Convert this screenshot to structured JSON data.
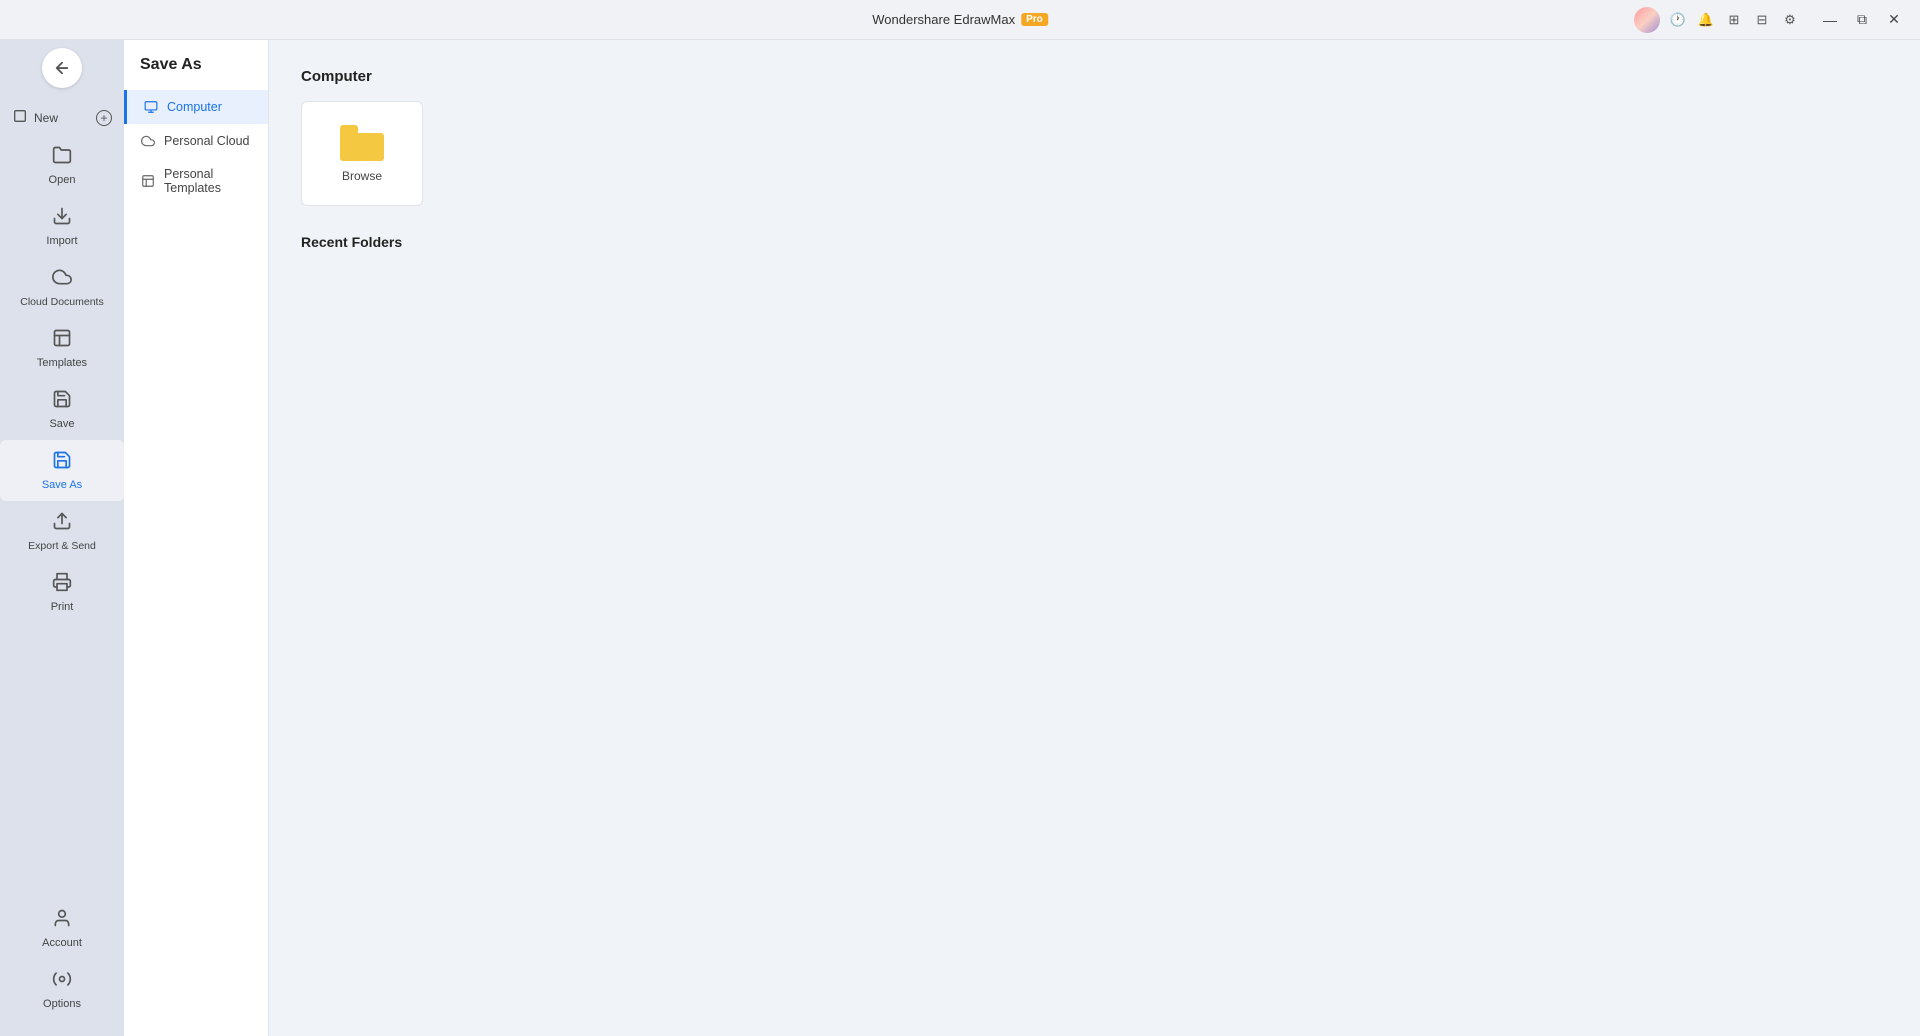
{
  "titleBar": {
    "appName": "Wondershare EdrawMax",
    "proBadge": "Pro",
    "winControls": {
      "minimize": "—",
      "restore": "⧉",
      "close": "✕"
    },
    "toolbarIcons": [
      "clock-icon",
      "bell-icon",
      "grid-icon",
      "filter-icon",
      "settings-icon"
    ]
  },
  "sidebar": {
    "backButton": "←",
    "navItems": [
      {
        "id": "new",
        "label": "New",
        "icon": "new-icon"
      },
      {
        "id": "open",
        "label": "Open",
        "icon": "open-icon"
      },
      {
        "id": "import",
        "label": "Import",
        "icon": "import-icon"
      },
      {
        "id": "cloud-documents",
        "label": "Cloud Documents",
        "icon": "cloud-icon"
      },
      {
        "id": "templates",
        "label": "Templates",
        "icon": "templates-icon"
      },
      {
        "id": "save",
        "label": "Save",
        "icon": "save-icon"
      },
      {
        "id": "save-as",
        "label": "Save As",
        "icon": "saveas-icon",
        "active": true
      },
      {
        "id": "export-send",
        "label": "Export & Send",
        "icon": "export-icon"
      },
      {
        "id": "print",
        "label": "Print",
        "icon": "print-icon"
      }
    ],
    "bottomItems": [
      {
        "id": "account",
        "label": "Account",
        "icon": "account-icon"
      },
      {
        "id": "options",
        "label": "Options",
        "icon": "options-icon"
      }
    ]
  },
  "saveAsPanel": {
    "title": "Save As",
    "menuItems": [
      {
        "id": "computer",
        "label": "Computer",
        "icon": "computer-icon",
        "active": true
      },
      {
        "id": "personal-cloud",
        "label": "Personal Cloud",
        "icon": "cloud-icon"
      },
      {
        "id": "personal-templates",
        "label": "Personal Templates",
        "icon": "templates-icon"
      }
    ]
  },
  "mainContent": {
    "sectionTitle": "Computer",
    "browseCard": {
      "label": "Browse"
    },
    "recentFoldersTitle": "Recent Folders"
  }
}
